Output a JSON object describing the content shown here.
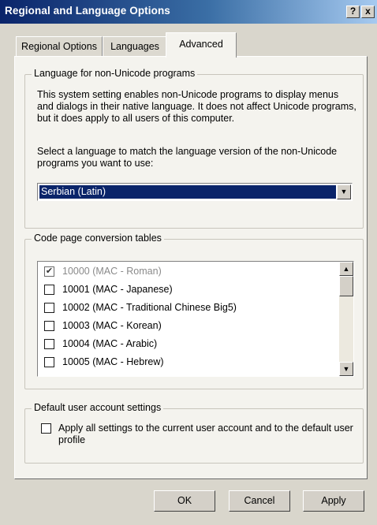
{
  "window": {
    "title": "Regional and Language Options",
    "help_label": "?",
    "close_label": "x"
  },
  "tabs": [
    {
      "label": "Regional Options",
      "selected": false
    },
    {
      "label": "Languages",
      "selected": false
    },
    {
      "label": "Advanced",
      "selected": true
    }
  ],
  "non_unicode": {
    "legend": "Language for non-Unicode programs",
    "description": "This system setting enables non-Unicode programs to display menus and dialogs in their native language. It does not affect Unicode programs, but it does apply to all users of this computer.",
    "instruction": "Select a language to match the language version of the non-Unicode programs you want to use:",
    "selected_language": "Serbian (Latin)"
  },
  "code_pages": {
    "legend": "Code page conversion tables",
    "items": [
      {
        "label": "10000 (MAC - Roman)",
        "checked": true,
        "disabled": true
      },
      {
        "label": "10001 (MAC - Japanese)",
        "checked": false,
        "disabled": false
      },
      {
        "label": "10002 (MAC - Traditional Chinese Big5)",
        "checked": false,
        "disabled": false
      },
      {
        "label": "10003 (MAC - Korean)",
        "checked": false,
        "disabled": false
      },
      {
        "label": "10004 (MAC - Arabic)",
        "checked": false,
        "disabled": false
      },
      {
        "label": "10005 (MAC - Hebrew)",
        "checked": false,
        "disabled": false
      }
    ]
  },
  "default_user": {
    "legend": "Default user account settings",
    "checkbox_label": "Apply all settings to the current user account and to the default user profile",
    "checked": false
  },
  "buttons": {
    "ok": "OK",
    "cancel": "Cancel",
    "apply": "Apply"
  }
}
